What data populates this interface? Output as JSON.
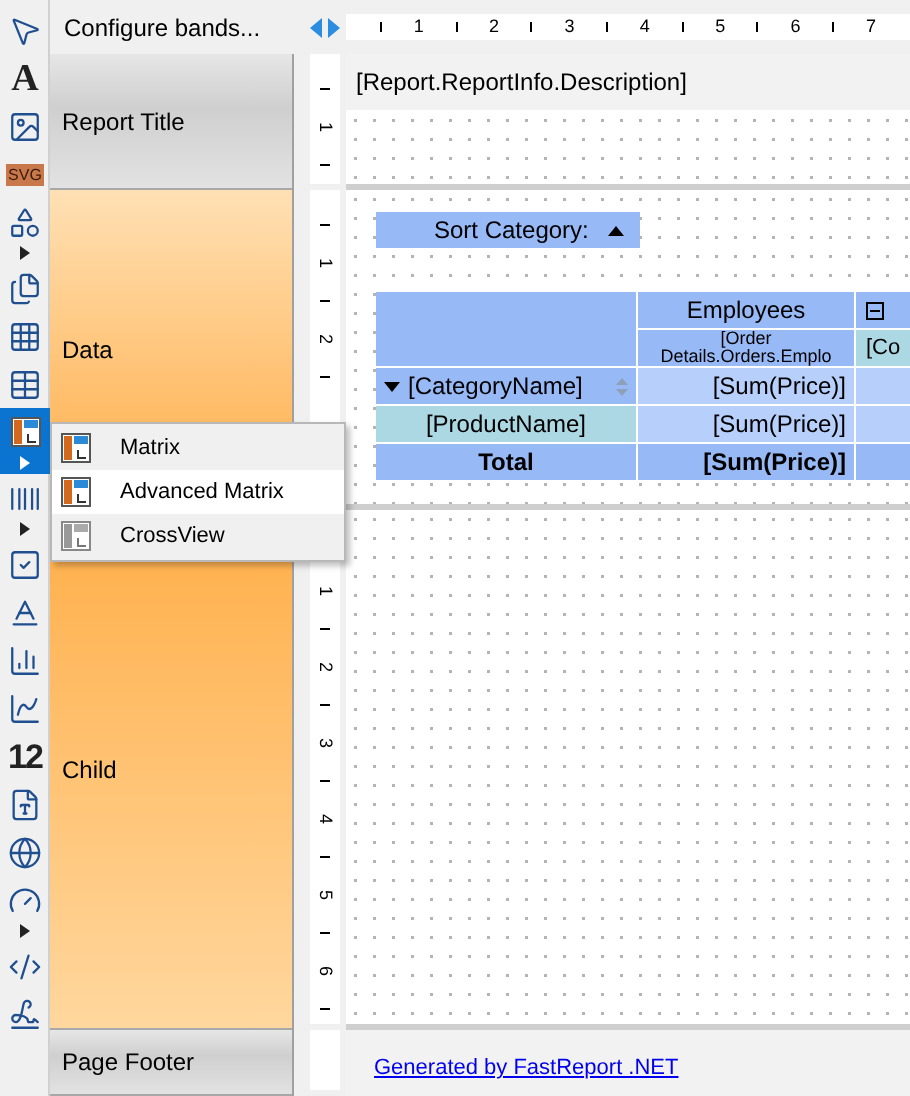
{
  "toolbar": [
    {
      "kind": "pointer",
      "selected": false,
      "more": false
    },
    {
      "kind": "text",
      "label": "A",
      "selected": false,
      "more": false
    },
    {
      "kind": "picture",
      "selected": false,
      "more": false
    },
    {
      "kind": "svg",
      "label": "SVG",
      "selected": false,
      "more": false
    },
    {
      "kind": "shape",
      "selected": false,
      "more": true
    },
    {
      "kind": "subreport",
      "selected": false,
      "more": false
    },
    {
      "kind": "grid",
      "selected": false,
      "more": false
    },
    {
      "kind": "table",
      "selected": false,
      "more": false
    },
    {
      "kind": "matrix",
      "selected": true,
      "more": true
    },
    {
      "kind": "barcode",
      "selected": false,
      "more": true
    },
    {
      "kind": "checkbox",
      "selected": false,
      "more": false
    },
    {
      "kind": "richtext",
      "selected": false,
      "more": false
    },
    {
      "kind": "chart",
      "selected": false,
      "more": false
    },
    {
      "kind": "sparkline",
      "selected": false,
      "more": false
    },
    {
      "kind": "digital",
      "label": "12",
      "selected": false,
      "more": false
    },
    {
      "kind": "zipcode",
      "selected": false,
      "more": false
    },
    {
      "kind": "map",
      "selected": false,
      "more": false
    },
    {
      "kind": "gauge",
      "selected": false,
      "more": true
    },
    {
      "kind": "html",
      "selected": false,
      "more": false
    },
    {
      "kind": "signature",
      "selected": false,
      "more": false
    }
  ],
  "band_panel": {
    "header": "Configure bands...",
    "bands": [
      {
        "name": "Report Title",
        "kind": "grey",
        "ruler": [
          "1"
        ]
      },
      {
        "name": "Data",
        "kind": "orange_down",
        "ruler": [
          "1",
          "2"
        ]
      },
      {
        "name": "Child",
        "kind": "orange_up",
        "ruler": [
          "1",
          "2",
          "3",
          "4",
          "5",
          "6"
        ]
      },
      {
        "name": "Page Footer",
        "kind": "grey"
      }
    ]
  },
  "horizontal_ruler": [
    "1",
    "2",
    "3",
    "4",
    "5",
    "6",
    "7"
  ],
  "popup_menu": [
    {
      "label": "Matrix",
      "kind": "matrix",
      "selected": false
    },
    {
      "label": "Advanced Matrix",
      "kind": "matrix",
      "selected": true
    },
    {
      "label": "CrossView",
      "kind": "crossview",
      "selected": false
    }
  ],
  "canvas": {
    "report_title": {
      "field": "[Report.ReportInfo.Description]"
    },
    "sort_button": {
      "label": "Sort Category:",
      "ascending": true
    },
    "matrix": {
      "column_header": "Employees",
      "column_field": "[Order Details.Orders.Emplo",
      "next_column_field": "[Co",
      "rows": [
        {
          "kind": "group",
          "label": "[CategoryName]",
          "value": "[Sum(Price)]"
        },
        {
          "kind": "item",
          "label": "[ProductName]",
          "value": "[Sum(Price)]"
        },
        {
          "kind": "total",
          "label": "Total",
          "value": "[Sum(Price)]"
        }
      ]
    },
    "footer": {
      "link": "Generated by FastReport .NET"
    }
  }
}
